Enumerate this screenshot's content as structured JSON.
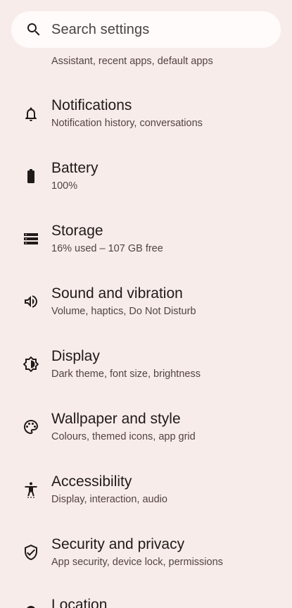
{
  "search": {
    "placeholder": "Search settings",
    "icon": "search-icon"
  },
  "partial_item": {
    "subtitle": "Assistant, recent apps, default apps"
  },
  "items": [
    {
      "title": "Notifications",
      "subtitle": "Notification history, conversations",
      "icon": "bell-icon"
    },
    {
      "title": "Battery",
      "subtitle": "100%",
      "icon": "battery-icon"
    },
    {
      "title": "Storage",
      "subtitle": "16% used – 107 GB free",
      "icon": "storage-icon"
    },
    {
      "title": "Sound and vibration",
      "subtitle": "Volume, haptics, Do Not Disturb",
      "icon": "speaker-icon"
    },
    {
      "title": "Display",
      "subtitle": "Dark theme, font size, brightness",
      "icon": "brightness-icon"
    },
    {
      "title": "Wallpaper and style",
      "subtitle": "Colours, themed icons, app grid",
      "icon": "palette-icon"
    },
    {
      "title": "Accessibility",
      "subtitle": "Display, interaction, audio",
      "icon": "accessibility-icon"
    },
    {
      "title": "Security and privacy",
      "subtitle": "App security, device lock, permissions",
      "icon": "shield-check-icon"
    },
    {
      "title": "Location",
      "subtitle": "",
      "icon": "location-icon"
    }
  ],
  "colors": {
    "background": "#f7ecea",
    "search_background": "#fffbfa",
    "text_primary": "#201a19",
    "text_secondary": "#534342"
  }
}
